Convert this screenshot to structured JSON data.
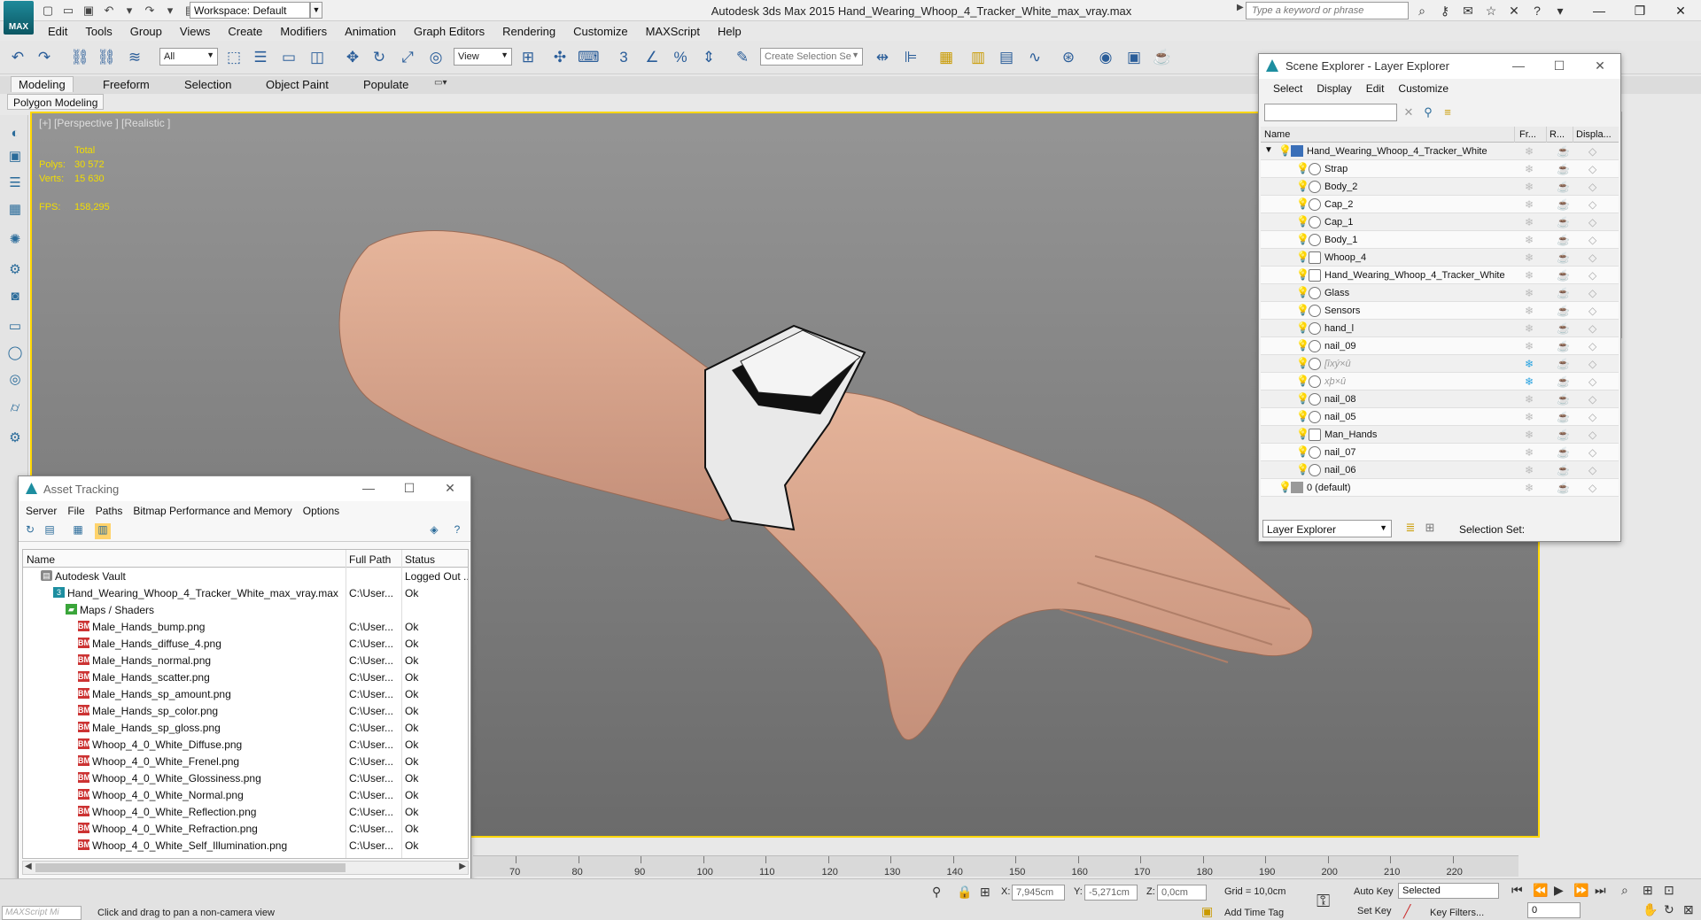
{
  "window": {
    "title": "Autodesk 3ds Max  2015     Hand_Wearing_Whoop_4_Tracker_White_max_vray.max",
    "logo_text": "MAX",
    "workspace": "Workspace: Default",
    "search_placeholder": "Type a keyword or phrase"
  },
  "menubar": [
    "Edit",
    "Tools",
    "Group",
    "Views",
    "Create",
    "Modifiers",
    "Animation",
    "Graph Editors",
    "Rendering",
    "Customize",
    "MAXScript",
    "Help"
  ],
  "toolbar": {
    "filter": "All",
    "coord_system": "View",
    "selection_set_placeholder": "Create Selection Se"
  },
  "ribbon": {
    "tabs": [
      "Modeling",
      "Freeform",
      "Selection",
      "Object Paint",
      "Populate"
    ],
    "active_tab": "Modeling",
    "panel": "Polygon Modeling"
  },
  "viewport": {
    "label": "[+] [Perspective ] [Realistic ]",
    "stats": {
      "total_label": "Total",
      "polys_label": "Polys:",
      "polys": "30 572",
      "verts_label": "Verts:",
      "verts": "15 630",
      "fps_label": "FPS:",
      "fps": "158,295"
    }
  },
  "scene_explorer": {
    "title": "Scene Explorer - Layer Explorer",
    "menu": [
      "Select",
      "Display",
      "Edit",
      "Customize"
    ],
    "columns": {
      "name": "Name",
      "frozen": "Fr...",
      "render": "R...",
      "display": "Displa..."
    },
    "rows": [
      {
        "name": "Hand_Wearing_Whoop_4_Tracker_White",
        "level": 0,
        "kind": "layer"
      },
      {
        "name": "Strap",
        "level": 1,
        "kind": "object"
      },
      {
        "name": "Body_2",
        "level": 1,
        "kind": "object"
      },
      {
        "name": "Cap_2",
        "level": 1,
        "kind": "object"
      },
      {
        "name": "Cap_1",
        "level": 1,
        "kind": "object"
      },
      {
        "name": "Body_1",
        "level": 1,
        "kind": "object"
      },
      {
        "name": "Whoop_4",
        "level": 1,
        "kind": "group"
      },
      {
        "name": "Hand_Wearing_Whoop_4_Tracker_White",
        "level": 1,
        "kind": "group"
      },
      {
        "name": "Glass",
        "level": 1,
        "kind": "object"
      },
      {
        "name": "Sensors",
        "level": 1,
        "kind": "object"
      },
      {
        "name": "hand_l",
        "level": 1,
        "kind": "object"
      },
      {
        "name": "nail_09",
        "level": 1,
        "kind": "object"
      },
      {
        "name": "[îxý×û",
        "level": 1,
        "kind": "ghost"
      },
      {
        "name": "xþ×û",
        "level": 1,
        "kind": "ghost"
      },
      {
        "name": "nail_08",
        "level": 1,
        "kind": "object"
      },
      {
        "name": "nail_05",
        "level": 1,
        "kind": "object"
      },
      {
        "name": "Man_Hands",
        "level": 1,
        "kind": "group"
      },
      {
        "name": "nail_07",
        "level": 1,
        "kind": "object"
      },
      {
        "name": "nail_06",
        "level": 1,
        "kind": "object"
      },
      {
        "name": "0 (default)",
        "level": 0,
        "kind": "default"
      }
    ],
    "explorer_type": "Layer Explorer",
    "selection_set_label": "Selection Set:"
  },
  "asset_tracking": {
    "title": "Asset Tracking",
    "menu": [
      "Server",
      "File",
      "Paths",
      "Bitmap Performance and Memory",
      "Options"
    ],
    "columns": {
      "name": "Name",
      "full_path": "Full Path",
      "status": "Status"
    },
    "rows": [
      {
        "name": "Autodesk Vault",
        "path": "",
        "status": "Logged Out ..",
        "level": 0,
        "icon": "vault"
      },
      {
        "name": "Hand_Wearing_Whoop_4_Tracker_White_max_vray.max",
        "path": "C:\\User...",
        "status": "Ok",
        "level": 1,
        "icon": "file"
      },
      {
        "name": "Maps / Shaders",
        "path": "",
        "status": "",
        "level": 2,
        "icon": "folder"
      },
      {
        "name": "Male_Hands_bump.png",
        "path": "C:\\User...",
        "status": "Ok",
        "level": 3,
        "icon": "bmp"
      },
      {
        "name": "Male_Hands_diffuse_4.png",
        "path": "C:\\User...",
        "status": "Ok",
        "level": 3,
        "icon": "bmp"
      },
      {
        "name": "Male_Hands_normal.png",
        "path": "C:\\User...",
        "status": "Ok",
        "level": 3,
        "icon": "bmp"
      },
      {
        "name": "Male_Hands_scatter.png",
        "path": "C:\\User...",
        "status": "Ok",
        "level": 3,
        "icon": "bmp"
      },
      {
        "name": "Male_Hands_sp_amount.png",
        "path": "C:\\User...",
        "status": "Ok",
        "level": 3,
        "icon": "bmp"
      },
      {
        "name": "Male_Hands_sp_color.png",
        "path": "C:\\User...",
        "status": "Ok",
        "level": 3,
        "icon": "bmp"
      },
      {
        "name": "Male_Hands_sp_gloss.png",
        "path": "C:\\User...",
        "status": "Ok",
        "level": 3,
        "icon": "bmp"
      },
      {
        "name": "Whoop_4_0_White_Diffuse.png",
        "path": "C:\\User...",
        "status": "Ok",
        "level": 3,
        "icon": "bmp"
      },
      {
        "name": "Whoop_4_0_White_Frenel.png",
        "path": "C:\\User...",
        "status": "Ok",
        "level": 3,
        "icon": "bmp"
      },
      {
        "name": "Whoop_4_0_White_Glossiness.png",
        "path": "C:\\User...",
        "status": "Ok",
        "level": 3,
        "icon": "bmp"
      },
      {
        "name": "Whoop_4_0_White_Normal.png",
        "path": "C:\\User...",
        "status": "Ok",
        "level": 3,
        "icon": "bmp"
      },
      {
        "name": "Whoop_4_0_White_Reflection.png",
        "path": "C:\\User...",
        "status": "Ok",
        "level": 3,
        "icon": "bmp"
      },
      {
        "name": "Whoop_4_0_White_Refraction.png",
        "path": "C:\\User...",
        "status": "Ok",
        "level": 3,
        "icon": "bmp"
      },
      {
        "name": "Whoop_4_0_White_Self_Illumination.png",
        "path": "C:\\User...",
        "status": "Ok",
        "level": 3,
        "icon": "bmp"
      }
    ]
  },
  "timeline": {
    "ticks": [
      "70",
      "80",
      "90",
      "100",
      "110",
      "120",
      "130",
      "140",
      "150",
      "160",
      "170",
      "180",
      "190",
      "200",
      "210",
      "220"
    ]
  },
  "statusbar": {
    "maxscript": "MAXScript Mi",
    "prompt": "Click and drag to pan a non-camera view",
    "x_label": "X:",
    "x": "7,945cm",
    "y_label": "Y:",
    "y": "-5,271cm",
    "z_label": "Z:",
    "z": "0,0cm",
    "grid": "Grid = 10,0cm",
    "add_time_tag": "Add Time Tag",
    "auto_key": "Auto Key",
    "set_key": "Set Key",
    "selected": "Selected",
    "key_filters": "Key Filters...",
    "frame": "0"
  }
}
